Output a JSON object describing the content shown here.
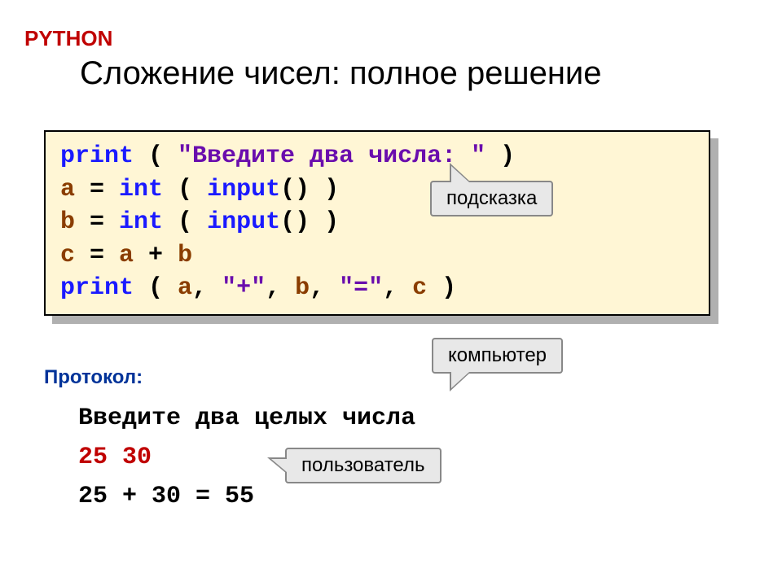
{
  "header": {
    "language": "PYTHON",
    "title": "Сложение чисел: полное решение"
  },
  "code": {
    "l1": {
      "kw": "print",
      "p1": " ( ",
      "str": "\"Введите два числа: \"",
      "p2": " )"
    },
    "l2": {
      "a": "a",
      "eq": " = ",
      "kw": "int",
      "p1": " ( ",
      "inp": "input",
      "par": "()",
      "p2": " )"
    },
    "l3": {
      "b": "b",
      "eq": " = ",
      "kw": "int",
      "p1": " ( ",
      "inp": "input",
      "par": "()",
      "p2": " )"
    },
    "l4": {
      "c": "c",
      "eq": " = ",
      "a": "a",
      "plus": " + ",
      "b": "b"
    },
    "l5": {
      "kw": "print",
      "p1": " ( ",
      "a": "a",
      "c1": ", ",
      "s1": "\"+\"",
      "c2": ", ",
      "b": "b",
      "c3": ", ",
      "s2": "\"=\"",
      "c4": ", ",
      "c": "c",
      "p2": " )"
    }
  },
  "callouts": {
    "hint": "подсказка",
    "computer": "компьютер",
    "user": "пользователь"
  },
  "protocol": {
    "label": "Протокол:",
    "line1": "Введите два целых числа",
    "input": "25 30",
    "result": "25 + 30 = 55"
  }
}
